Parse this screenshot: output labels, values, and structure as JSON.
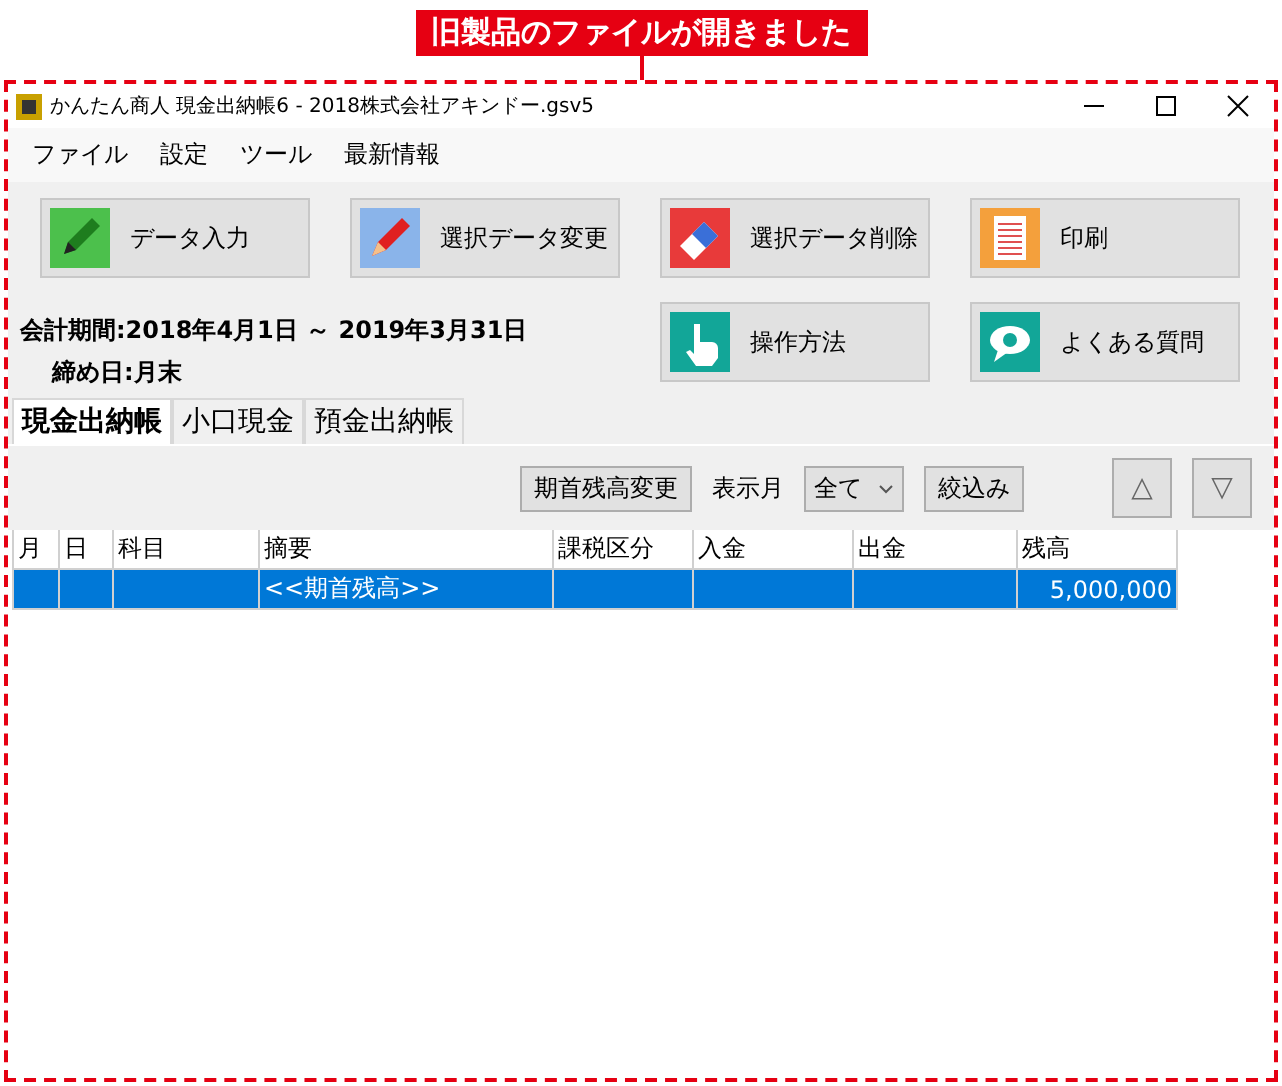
{
  "annotation": {
    "label": "旧製品のファイルが開きました"
  },
  "window": {
    "title": "かんたん商人 現金出納帳6 - 2018株式会社アキンドー.gsv5"
  },
  "menu": [
    "ファイル",
    "設定",
    "ツール",
    "最新情報"
  ],
  "action_buttons": [
    {
      "label": "データ入力",
      "kind": "pencil"
    },
    {
      "label": "選択データ変更",
      "kind": "pen"
    },
    {
      "label": "選択データ削除",
      "kind": "eraser"
    },
    {
      "label": "印刷",
      "kind": "print"
    },
    {
      "label": "操作方法",
      "kind": "hand"
    },
    {
      "label": "よくある質問",
      "kind": "faq"
    }
  ],
  "period": {
    "label": "会計期間:2018年4月1日 ～ 2019年3月31日",
    "closing": "締め日:月末"
  },
  "tabs": [
    {
      "label": "現金出納帳",
      "selected": true
    },
    {
      "label": "小口現金",
      "selected": false
    },
    {
      "label": "預金出納帳",
      "selected": false
    }
  ],
  "toolbar": {
    "opening_balance_button": "期首残高変更",
    "month_label": "表示月",
    "month_select": "全て",
    "filter_button": "絞込み",
    "up_button": "△",
    "down_button": "▽"
  },
  "table": {
    "columns": [
      "月",
      "日",
      "科目",
      "摘要",
      "課税区分",
      "入金",
      "出金",
      "残高"
    ],
    "rows": [
      {
        "cells": [
          "",
          "",
          "",
          "<<期首残高>>",
          "",
          "",
          "",
          "5,000,000"
        ],
        "selected": true
      }
    ]
  }
}
